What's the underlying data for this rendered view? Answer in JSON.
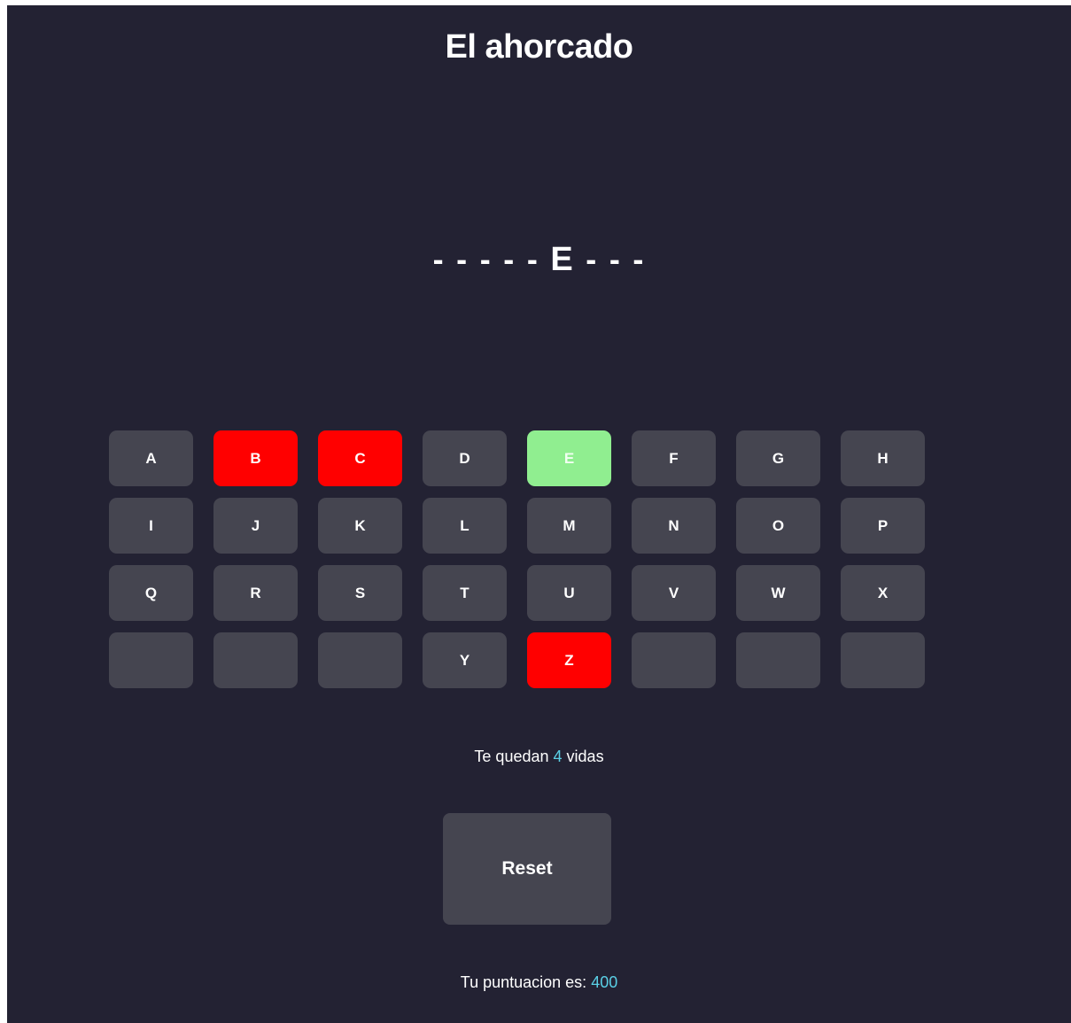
{
  "title": "El ahorcado",
  "word_slots": [
    "-",
    "-",
    "-",
    "-",
    "-",
    "E",
    "-",
    "-",
    "-"
  ],
  "keyboard": [
    {
      "label": "A",
      "state": "default"
    },
    {
      "label": "B",
      "state": "wrong"
    },
    {
      "label": "C",
      "state": "wrong"
    },
    {
      "label": "D",
      "state": "default"
    },
    {
      "label": "E",
      "state": "right"
    },
    {
      "label": "F",
      "state": "default"
    },
    {
      "label": "G",
      "state": "default"
    },
    {
      "label": "H",
      "state": "default"
    },
    {
      "label": "I",
      "state": "default"
    },
    {
      "label": "J",
      "state": "default"
    },
    {
      "label": "K",
      "state": "default"
    },
    {
      "label": "L",
      "state": "default"
    },
    {
      "label": "M",
      "state": "default"
    },
    {
      "label": "N",
      "state": "default"
    },
    {
      "label": "O",
      "state": "default"
    },
    {
      "label": "P",
      "state": "default"
    },
    {
      "label": "Q",
      "state": "default"
    },
    {
      "label": "R",
      "state": "default"
    },
    {
      "label": "S",
      "state": "default"
    },
    {
      "label": "T",
      "state": "default"
    },
    {
      "label": "U",
      "state": "default"
    },
    {
      "label": "V",
      "state": "default"
    },
    {
      "label": "W",
      "state": "default"
    },
    {
      "label": "X",
      "state": "default"
    },
    {
      "label": "",
      "state": "blank"
    },
    {
      "label": "",
      "state": "blank"
    },
    {
      "label": "",
      "state": "blank"
    },
    {
      "label": "Y",
      "state": "default"
    },
    {
      "label": "Z",
      "state": "wrong"
    },
    {
      "label": "",
      "state": "blank"
    },
    {
      "label": "",
      "state": "blank"
    },
    {
      "label": "",
      "state": "blank"
    }
  ],
  "lives": {
    "prefix": "Te quedan",
    "count": "4",
    "suffix": "vidas"
  },
  "reset_label": "Reset",
  "score": {
    "label": "Tu puntuacion es:",
    "value": "400"
  },
  "colors": {
    "background": "#232233",
    "key": "#454550",
    "wrong": "#ff0000",
    "right": "#90ee90",
    "accent": "#5ad0e6"
  }
}
